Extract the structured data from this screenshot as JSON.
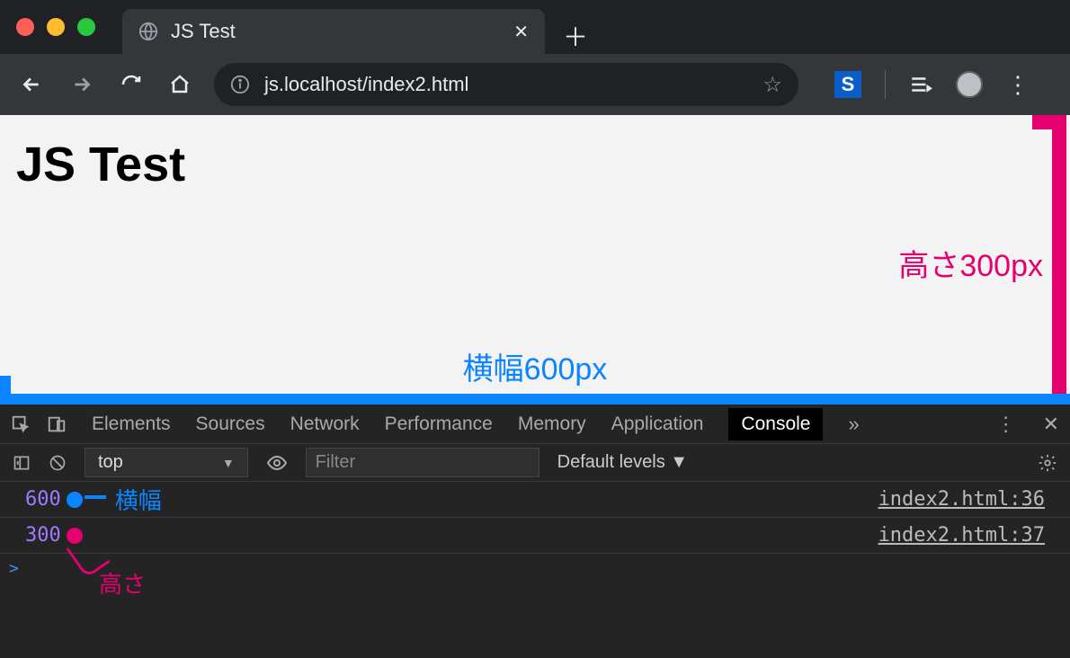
{
  "tab": {
    "title": "JS Test"
  },
  "omnibox": {
    "url": "js.localhost/index2.html"
  },
  "page": {
    "heading": "JS Test",
    "annot_height": "高さ300px",
    "annot_width": "横幅600px"
  },
  "devtools": {
    "tabs": [
      "Elements",
      "Sources",
      "Network",
      "Performance",
      "Memory",
      "Application",
      "Console"
    ],
    "active_tab": "Console",
    "context": "top",
    "filter_placeholder": "Filter",
    "levels": "Default levels ▼",
    "log": [
      {
        "value": "600",
        "source": "index2.html:36",
        "annot": "横幅",
        "annot_color": "blue"
      },
      {
        "value": "300",
        "source": "index2.html:37",
        "annot": "高さ",
        "annot_color": "pink"
      }
    ],
    "prompt": ">"
  }
}
